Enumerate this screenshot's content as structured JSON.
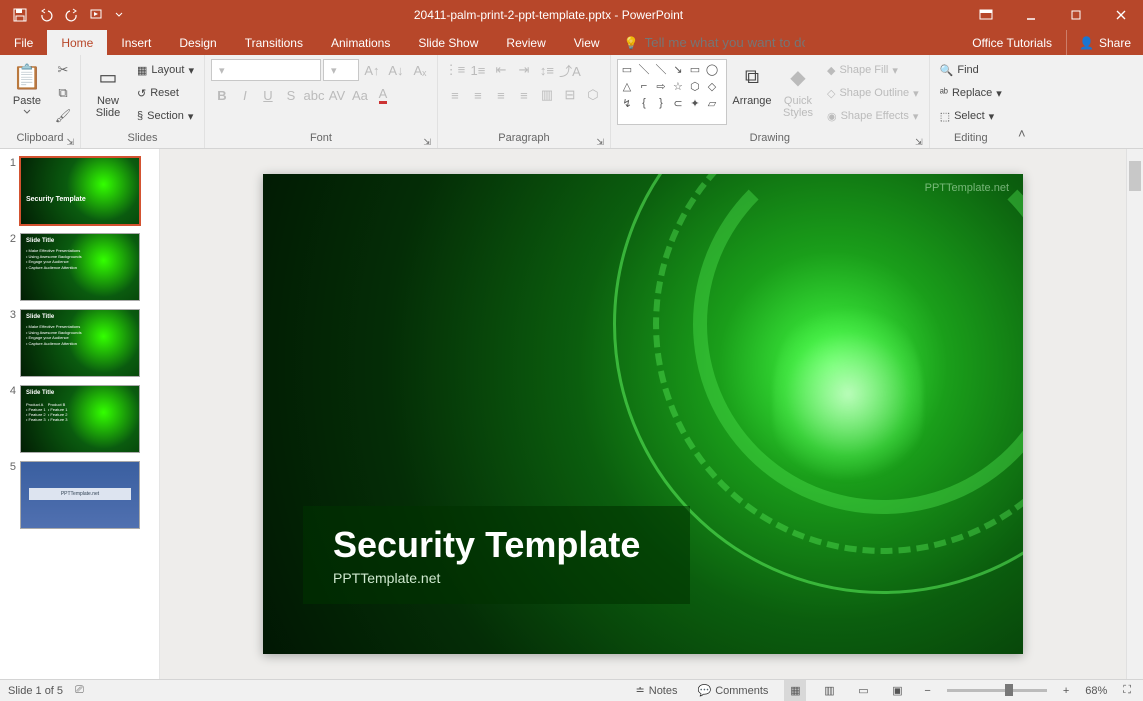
{
  "titlebar": {
    "filename": "20411-palm-print-2-ppt-template.pptx",
    "appname": "PowerPoint"
  },
  "tabs": {
    "file": "File",
    "home": "Home",
    "insert": "Insert",
    "design": "Design",
    "transitions": "Transitions",
    "animations": "Animations",
    "slideshow": "Slide Show",
    "review": "Review",
    "view": "View",
    "tellme_placeholder": "Tell me what you want to do...",
    "officetutorials": "Office Tutorials",
    "share": "Share"
  },
  "ribbon": {
    "clipboard": {
      "label": "Clipboard",
      "paste": "Paste",
      "cut": "Cut",
      "copy": "Copy",
      "formatpainter": "Format Painter"
    },
    "slides": {
      "label": "Slides",
      "newslide": "New\nSlide",
      "layout": "Layout",
      "reset": "Reset",
      "section": "Section"
    },
    "font": {
      "label": "Font"
    },
    "paragraph": {
      "label": "Paragraph"
    },
    "drawing": {
      "label": "Drawing",
      "arrange": "Arrange",
      "quick": "Quick\nStyles",
      "shapefill": "Shape Fill",
      "shapeoutline": "Shape Outline",
      "shapeeffects": "Shape Effects"
    },
    "editing": {
      "label": "Editing",
      "find": "Find",
      "replace": "Replace",
      "select": "Select"
    }
  },
  "thumbnails": [
    {
      "num": "1",
      "title": "Security Template",
      "type": "green",
      "selected": true
    },
    {
      "num": "2",
      "title": "Slide Title",
      "type": "green",
      "lines": [
        "Make Effective Presentations",
        "Using Awesome Backgrounds",
        "Engage your Audience",
        "Capture Audience Attention"
      ]
    },
    {
      "num": "3",
      "title": "Slide Title",
      "type": "green",
      "lines": [
        "Make Effective Presentations",
        "Using Awesome Backgrounds",
        "Engage your Audience",
        "Capture Audience Attention"
      ]
    },
    {
      "num": "4",
      "title": "Slide Title",
      "type": "green",
      "twocol": true
    },
    {
      "num": "5",
      "title": "PPTTemplate.net",
      "type": "blue"
    }
  ],
  "slide": {
    "title": "Security Template",
    "subtitle": "PPTTemplate.net",
    "watermark": "PPTTemplate.net"
  },
  "statusbar": {
    "slideinfo": "Slide 1 of 5",
    "notes": "Notes",
    "comments": "Comments",
    "zoom": "68%"
  }
}
